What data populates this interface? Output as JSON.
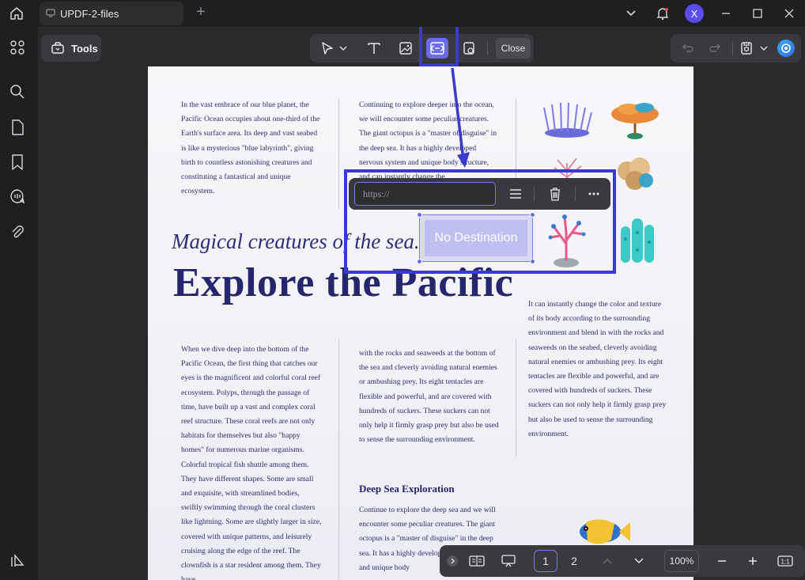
{
  "titlebar": {
    "tab_title": "UPDF-2-files",
    "avatar_letter": "X"
  },
  "toolbar": {
    "tools_label": "Tools",
    "close_label": "Close",
    "zoom_level": "100%"
  },
  "link_popup": {
    "url_placeholder": "https://",
    "destination_label": "No Destination"
  },
  "pagination": {
    "pages": [
      "1",
      "2"
    ],
    "current": "1"
  },
  "document": {
    "col1_top": "In the vast embrace of our blue planet, the Pacific Ocean occupies about one-third of the Earth's surface area. Its deep and vast seabed is like a mysterious \"blue labyrinth\", giving birth to countless astonishing creatures and constituting a fantastical and unique ecosystem.",
    "col2_top": "Continuing to explore deeper into the ocean, we will encounter some peculiar creatures. The giant octopus is a \"master of disguise\" in the deep sea. It has a highly developed nervous system and unique body structure, and can instantly change the",
    "subtitle": "Magical creatures of the sea.",
    "headline": "Explore the Pacific",
    "col3_mid": "It can instantly change the color and texture of its body according to the surrounding environment and blend in with the rocks and seaweeds on the seabed, cleverly avoiding natural enemies or ambushing prey. Its eight tentacles are flexible and powerful, and are covered with hundreds of suckers. These suckers can not only help it firmly grasp prey but also be used to sense the surrounding environment.",
    "col1_bottom": "When we dive deep into the bottom of the Pacific Ocean, the first thing that catches our eyes is the magnificent and colorful coral reef ecosystem. Polyps, through the passage of time, have built up a vast and complex coral reef structure. These coral reefs are not only habitats for themselves but also \"happy homes\" for numerous marine organisms. Colorful tropical fish shuttle among them. They have different shapes. Some are small and exquisite, with streamlined bodies, swiftly swimming through the coral clusters like lightning. Some are slightly larger in size, covered with unique patterns, and leisurely cruising along the edge of the reef. The clownfish is a star resident among them. They have",
    "col2_bottom": "with the rocks and seaweeds at the bottom of the sea and cleverly avoiding natural enemies or ambushing prey. Its eight tentacles are flexible and powerful, and are covered with hundreds of suckers. These suckers can not only help it firmly grasp prey but also be used to sense the surrounding environment.",
    "section_heading": "Deep Sea Exploration",
    "col2_section": "Continue to explore the deep sea and we will encounter some peculiar creatures. The giant octopus is a \"master of disguise\" in the deep sea. It has a highly developed nervous system and unique body"
  },
  "colors": {
    "accent": "#6b6bee",
    "highlight": "#3a3ad0",
    "text": "#26266e"
  }
}
